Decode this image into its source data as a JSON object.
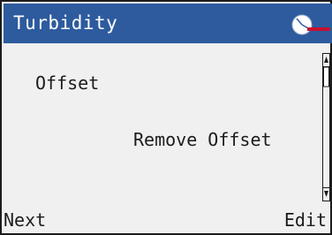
{
  "header": {
    "title": "Turbidity",
    "status_icon": "clock-status-icon"
  },
  "main": {
    "parameter_label": "Offset",
    "parameter_value": "Remove Offset"
  },
  "softkeys": {
    "left_label": "Next",
    "right_label": "Edit"
  },
  "colors": {
    "title_background": "#2d5b9e",
    "screen_background": "#f0f0f0",
    "text": "#1c1c1c",
    "clock_hand": "#c8102e"
  }
}
